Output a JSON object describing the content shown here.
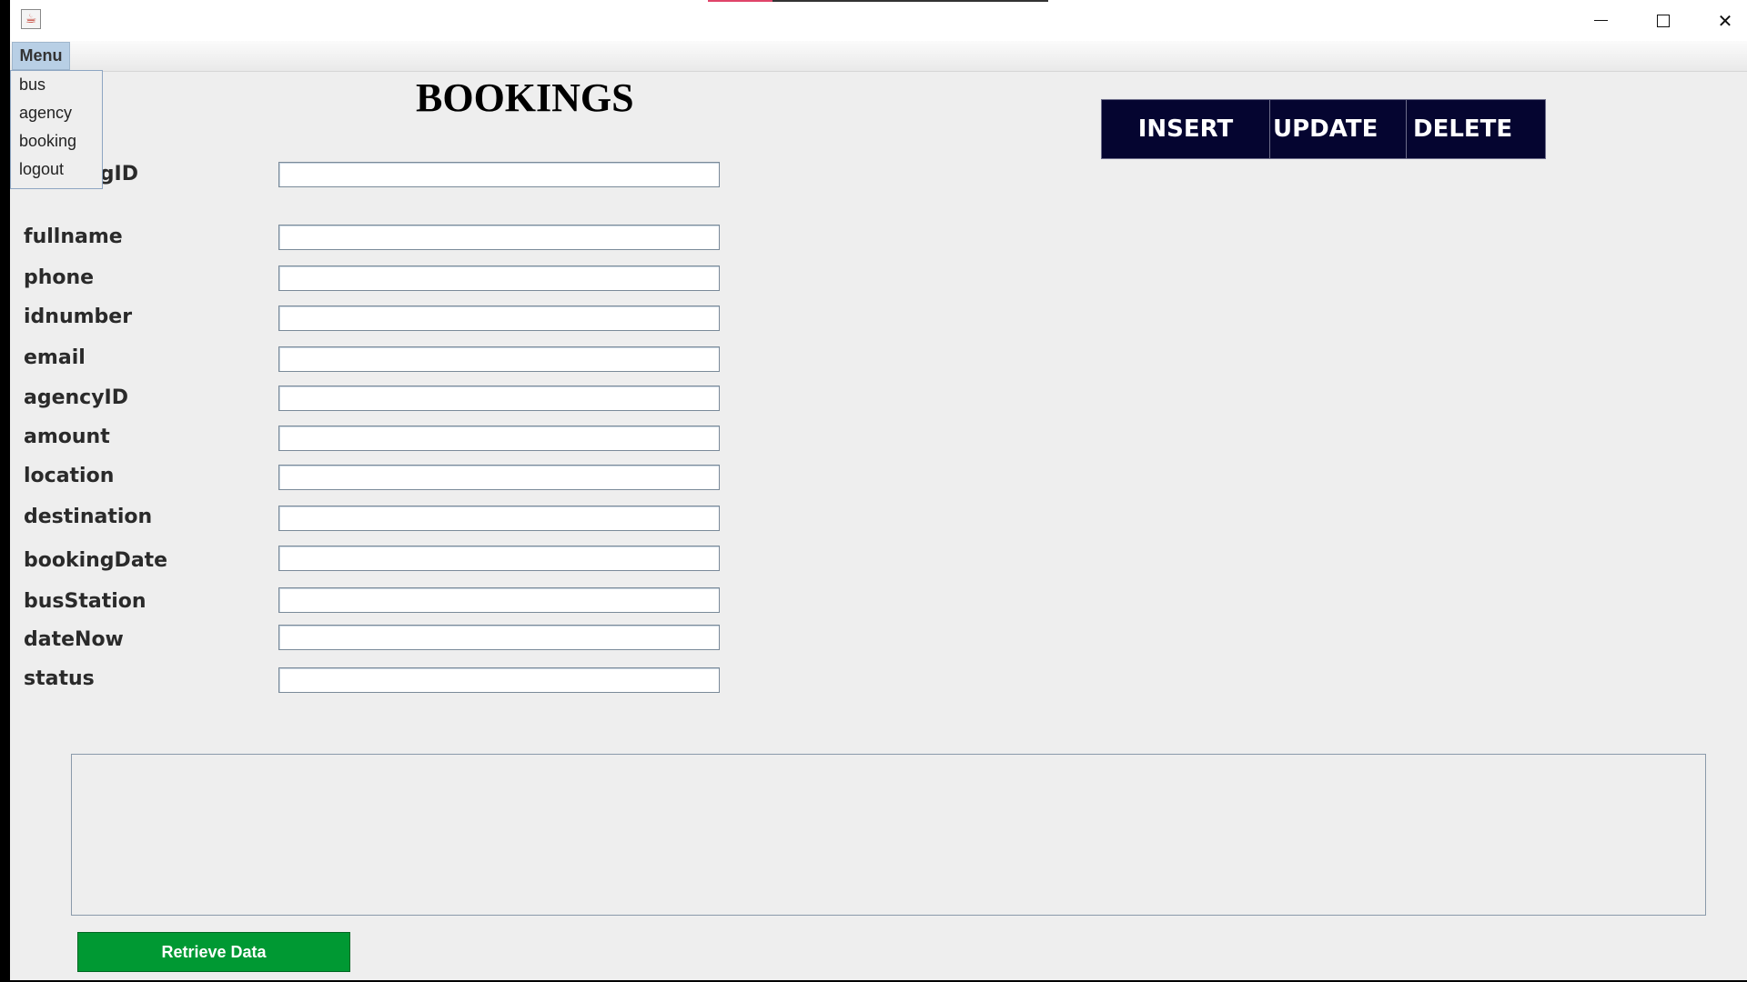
{
  "window": {
    "title": "",
    "controls": {
      "minimize": "minimize-icon",
      "maximize": "maximize-icon",
      "close": "close-icon"
    }
  },
  "menubar": {
    "menu_label": "Menu",
    "items": [
      {
        "label": "bus"
      },
      {
        "label": "agency"
      },
      {
        "label": "booking"
      },
      {
        "label": "logout"
      }
    ]
  },
  "form": {
    "heading": "BOOKINGS",
    "fields": [
      {
        "label": "bookingID",
        "value": ""
      },
      {
        "label": "fullname",
        "value": ""
      },
      {
        "label": "phone",
        "value": ""
      },
      {
        "label": "idnumber",
        "value": ""
      },
      {
        "label": "email",
        "value": ""
      },
      {
        "label": "agencyID",
        "value": ""
      },
      {
        "label": "amount",
        "value": ""
      },
      {
        "label": "location",
        "value": ""
      },
      {
        "label": "destination",
        "value": ""
      },
      {
        "label": "bookingDate",
        "value": ""
      },
      {
        "label": "busStation",
        "value": ""
      },
      {
        "label": "dateNow",
        "value": ""
      },
      {
        "label": "status",
        "value": ""
      }
    ]
  },
  "actions": {
    "insert": "INSERT",
    "update": "UPDATE",
    "delete": "DELETE"
  },
  "footer": {
    "retrieve_label": "Retrieve Data"
  },
  "colors": {
    "action_bg": "#050530",
    "retrieve_bg": "#009933",
    "menu_highlight": "#b8cfe5"
  }
}
